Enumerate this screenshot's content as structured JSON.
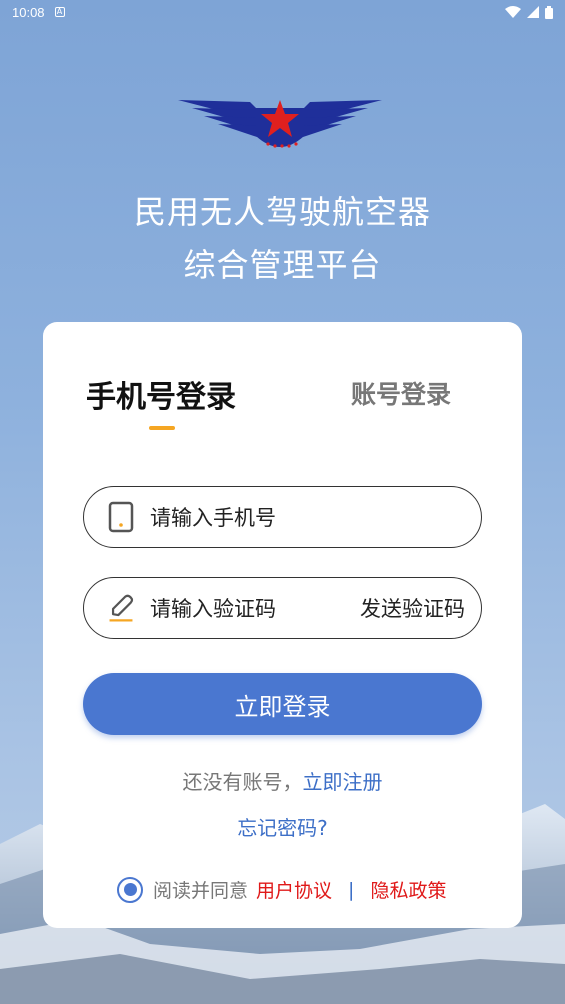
{
  "status_bar": {
    "time": "10:08",
    "notification_letter": "A"
  },
  "app": {
    "title_line1": "民用无人驾驶航空器",
    "title_line2": "综合管理平台"
  },
  "login_card": {
    "tab_phone": "手机号登录",
    "tab_account": "账号登录",
    "phone_placeholder": "请输入手机号",
    "code_placeholder": "请输入验证码",
    "send_code": "发送验证码",
    "login_button": "立即登录",
    "register_prefix": "还没有账号，",
    "register_link": "立即注册",
    "forgot_password": "忘记密码?",
    "agree_prefix": "阅读并同意",
    "user_agreement": "用户协议",
    "separator": "|",
    "privacy_policy": "隐私政策",
    "agreement_checked": true
  },
  "colors": {
    "accent": "#4a77d0",
    "tab_indicator": "#f5a623",
    "link": "#3d6fc7",
    "policy_link": "#e01919"
  },
  "icons": [
    "wifi-icon",
    "battery-icon",
    "phone-icon",
    "pencil-icon",
    "radio-checked-icon"
  ]
}
